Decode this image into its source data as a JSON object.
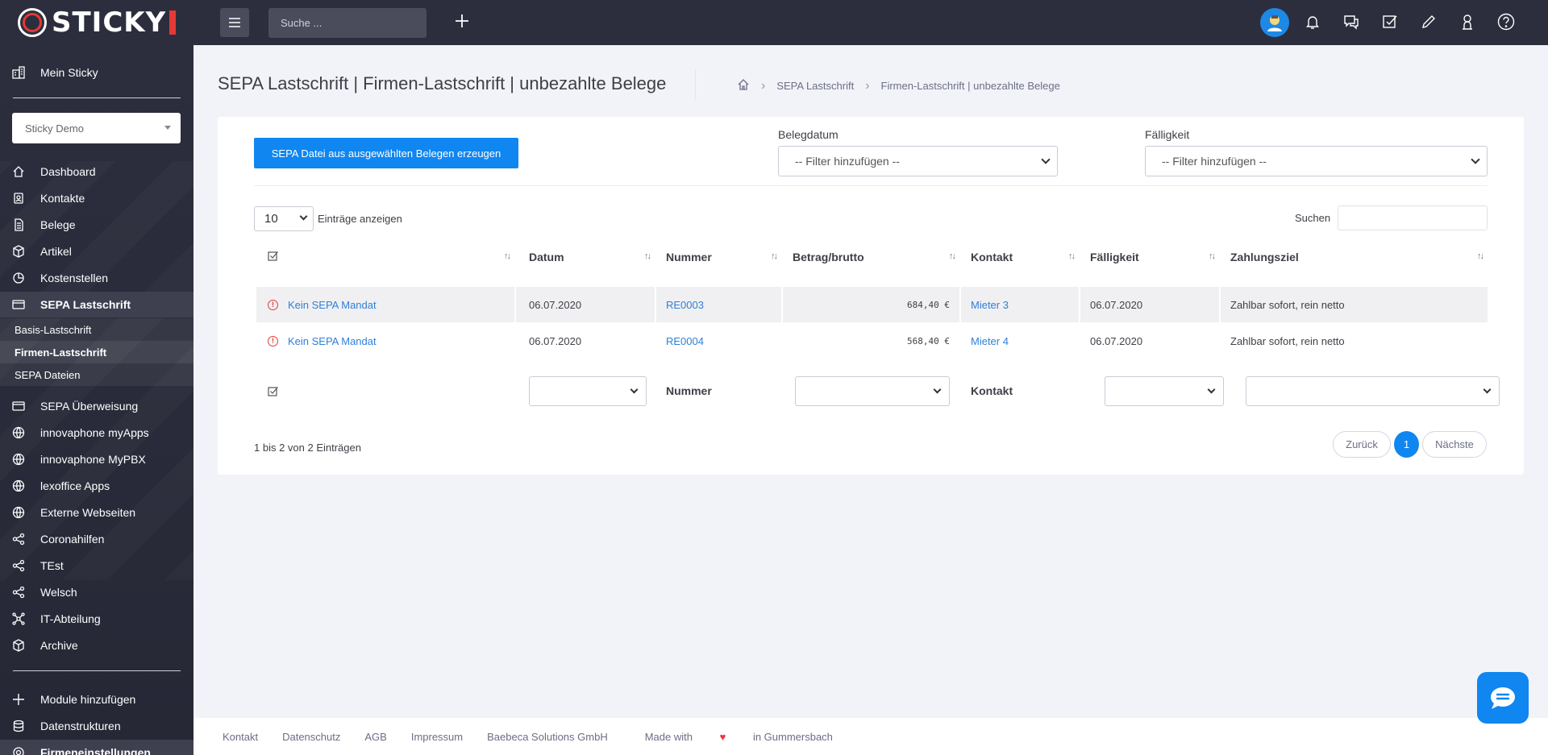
{
  "app": {
    "name": "STICKY"
  },
  "topbar": {
    "search_placeholder": "Suche ..."
  },
  "sidebar": {
    "mein_sticky": "Mein Sticky",
    "workspace_select": "Sticky Demo",
    "items": [
      {
        "label": "Dashboard",
        "icon": "home-icon"
      },
      {
        "label": "Kontakte",
        "icon": "contacts-icon"
      },
      {
        "label": "Belege",
        "icon": "document-icon"
      },
      {
        "label": "Artikel",
        "icon": "box-icon"
      },
      {
        "label": "Kostenstellen",
        "icon": "pie-icon"
      },
      {
        "label": "SEPA Lastschrift",
        "icon": "card-icon"
      }
    ],
    "subitems": [
      {
        "label": "Basis-Lastschrift"
      },
      {
        "label": "Firmen-Lastschrift"
      },
      {
        "label": "SEPA Dateien"
      }
    ],
    "items2": [
      {
        "label": "SEPA Überweisung",
        "icon": "card-icon"
      },
      {
        "label": "innovaphone myApps",
        "icon": "globe-icon"
      },
      {
        "label": "innovaphone MyPBX",
        "icon": "globe-icon"
      },
      {
        "label": "lexoffice Apps",
        "icon": "globe-icon"
      },
      {
        "label": "Externe Webseiten",
        "icon": "globe-icon"
      },
      {
        "label": "Coronahilfen",
        "icon": "share-icon"
      },
      {
        "label": "TEst",
        "icon": "share-icon"
      },
      {
        "label": "Welsch",
        "icon": "share-icon"
      },
      {
        "label": "IT-Abteilung",
        "icon": "network-icon"
      },
      {
        "label": "Archive",
        "icon": "box-icon"
      }
    ],
    "bottom": [
      {
        "label": "Module hinzufügen",
        "icon": "plus-icon"
      },
      {
        "label": "Datenstrukturen",
        "icon": "database-icon"
      },
      {
        "label": "Firmeneinstellungen",
        "icon": "gear-icon"
      }
    ]
  },
  "page": {
    "title": "SEPA Lastschrift | Firmen-Lastschrift | unbezahlte Belege",
    "breadcrumb": [
      "SEPA Lastschrift",
      "Firmen-Lastschrift | unbezahlte Belege"
    ]
  },
  "card": {
    "primary_button": "SEPA Datei aus ausgewählten Belegen erzeugen",
    "filters": [
      {
        "label": "Belegdatum",
        "value": "-- Filter hinzufügen --"
      },
      {
        "label": "Fälligkeit",
        "value": "-- Filter hinzufügen --"
      }
    ],
    "page_length": "10",
    "page_length_label": "Einträge anzeigen",
    "search_label": "Suchen"
  },
  "table": {
    "columns": [
      "Datum",
      "Nummer",
      "Betrag/brutto",
      "Kontakt",
      "Fälligkeit",
      "Zahlungsziel"
    ],
    "rows": [
      {
        "status": "Kein SEPA Mandat",
        "datum": "06.07.2020",
        "nummer": "RE0003",
        "betrag": "684,40 €",
        "kontakt": "Mieter 3",
        "faelligkeit": "06.07.2020",
        "zahlungsziel": "Zahlbar sofort, rein netto"
      },
      {
        "status": "Kein SEPA Mandat",
        "datum": "06.07.2020",
        "nummer": "RE0004",
        "betrag": "568,40 €",
        "kontakt": "Mieter 4",
        "faelligkeit": "06.07.2020",
        "zahlungsziel": "Zahlbar sofort, rein netto"
      }
    ],
    "footer_labels": {
      "nummer": "Nummer",
      "kontakt": "Kontakt"
    },
    "info": "1 bis 2 von 2 Einträgen",
    "pagination": {
      "prev": "Zurück",
      "current": "1",
      "next": "Nächste"
    }
  },
  "footer": {
    "links": [
      "Kontakt",
      "Datenschutz",
      "AGB",
      "Impressum",
      "Baebeca Solutions GmbH"
    ],
    "made_with": "Made with",
    "heart": "♥",
    "location": "in Gummersbach"
  }
}
